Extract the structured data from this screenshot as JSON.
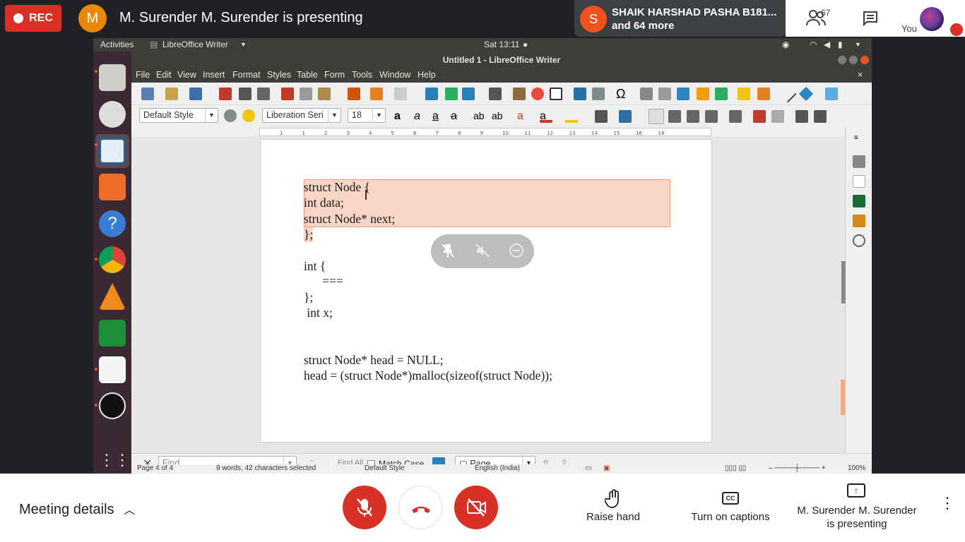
{
  "meet": {
    "rec_label": "REC",
    "presenter_initial": "M",
    "presenting_text": "M. Surender M. Surender is presenting",
    "participant_initial": "S",
    "participant_name": "SHAIK HARSHAD PASHA B181...",
    "participant_more": "and 64 more",
    "people_count": "67",
    "you_label": "You",
    "meeting_details": "Meeting details",
    "raise_hand": "Raise hand",
    "captions": "Turn on captions",
    "presenting_line1": "M. Surender M. Surender",
    "presenting_line2": "is presenting"
  },
  "ubuntu": {
    "activities": "Activities",
    "app_menu": "LibreOffice Writer",
    "clock": "Sat 13:11"
  },
  "writer": {
    "title": "Untitled 1 - LibreOffice Writer",
    "menus": [
      "File",
      "Edit",
      "View",
      "Insert",
      "Format",
      "Styles",
      "Table",
      "Form",
      "Tools",
      "Window",
      "Help"
    ],
    "para_style": "Default Style",
    "font_name": "Liberation Seri",
    "font_size": "18",
    "find_placeholder": "Find",
    "find_all": "Find All",
    "match_case": "Match Case",
    "page_combo": "Page",
    "status": {
      "page": "Page 4 of 4",
      "words": "9 words, 42 characters selected",
      "style": "Default Style",
      "lang": "English (India)",
      "zoom": "100%"
    },
    "ruler_marks": [
      "1",
      "1",
      "2",
      "3",
      "4",
      "5",
      "6",
      "7",
      "8",
      "9",
      "10",
      "11",
      "12",
      "13",
      "14",
      "15",
      "16",
      "18"
    ]
  },
  "document": {
    "lines": [
      "struct Node {",
      "int data;",
      "struct Node* next;",
      "};",
      "int {",
      "      ===",
      "};",
      " int x;",
      "struct Node* head = NULL;",
      "head = (struct Node*)malloc(sizeof(struct Node));"
    ]
  }
}
